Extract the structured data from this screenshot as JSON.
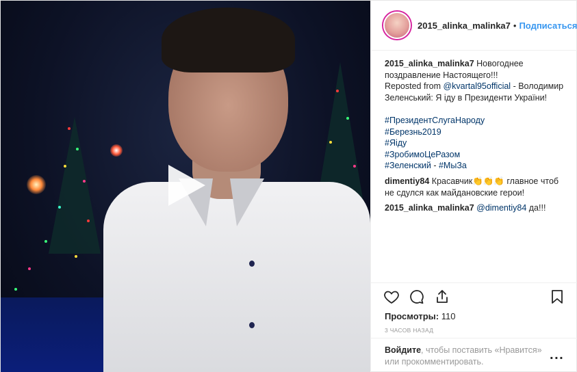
{
  "video": {
    "play_icon": "play-icon"
  },
  "header": {
    "username": "2015_alinka_malinka7",
    "separator": "•",
    "follow_label": "Подписаться"
  },
  "caption": {
    "username": "2015_alinka_malinka7",
    "text": "Новогоднее поздравление Настоящего!!!",
    "reposted_prefix": "Reposted from",
    "reposted_user": "@kvartal95official",
    "reposted_text": " - Володимир Зеленський: Я іду в Президенти України!",
    "hashtags": [
      "#ПрезидентСлугаНароду",
      "#Березнь2019",
      "#Яіду",
      "#ЗробимоЦеРазом"
    ],
    "hashtag_last": "#Зеленский",
    "hashtag_sep": " - ",
    "hashtag_final": "#МыЗа"
  },
  "comments": [
    {
      "username": "dimentiy84",
      "text": "Красавчик👏👏👏 главное чтоб не сдулся как майдановские герои!"
    },
    {
      "username": "2015_alinka_malinka7",
      "mention": "@dimentiy84",
      "text": " да!!!"
    }
  ],
  "actions": {
    "like_icon": "heart-icon",
    "comment_icon": "comment-icon",
    "share_icon": "share-icon",
    "save_icon": "bookmark-icon"
  },
  "stats": {
    "views_label": "Просмотры:",
    "views_count": "110",
    "time_ago": "3 часов назад"
  },
  "login": {
    "link": "Войдите",
    "text": ", чтобы поставить «Нравится» или прокомментировать.",
    "more": "..."
  }
}
